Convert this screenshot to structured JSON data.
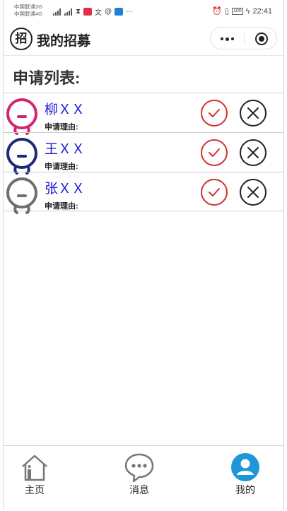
{
  "status_bar": {
    "carrier_1": "中国联通3G",
    "carrier_2": "中国联通4G",
    "battery": "100",
    "time": "22:41"
  },
  "header": {
    "logo_char": "招",
    "title": "我的招募"
  },
  "section_title": "申请列表:",
  "applicants": [
    {
      "name": "柳ＸＸ",
      "reason_label": "申请理由:",
      "avatar_color": "#d4266e"
    },
    {
      "name": "王ＸＸ",
      "reason_label": "申请理由:",
      "avatar_color": "#1e2a78"
    },
    {
      "name": "张ＸＸ",
      "reason_label": "申请理由:",
      "avatar_color": "#6f6f6f"
    }
  ],
  "tabs": [
    {
      "label": "主页",
      "icon": "home-icon"
    },
    {
      "label": "消息",
      "icon": "message-icon"
    },
    {
      "label": "我的",
      "icon": "profile-icon"
    }
  ],
  "colors": {
    "accept": "#d0312d",
    "reject": "#222222",
    "name_text": "#1a1adb",
    "active_tab": "#1e96d8"
  }
}
